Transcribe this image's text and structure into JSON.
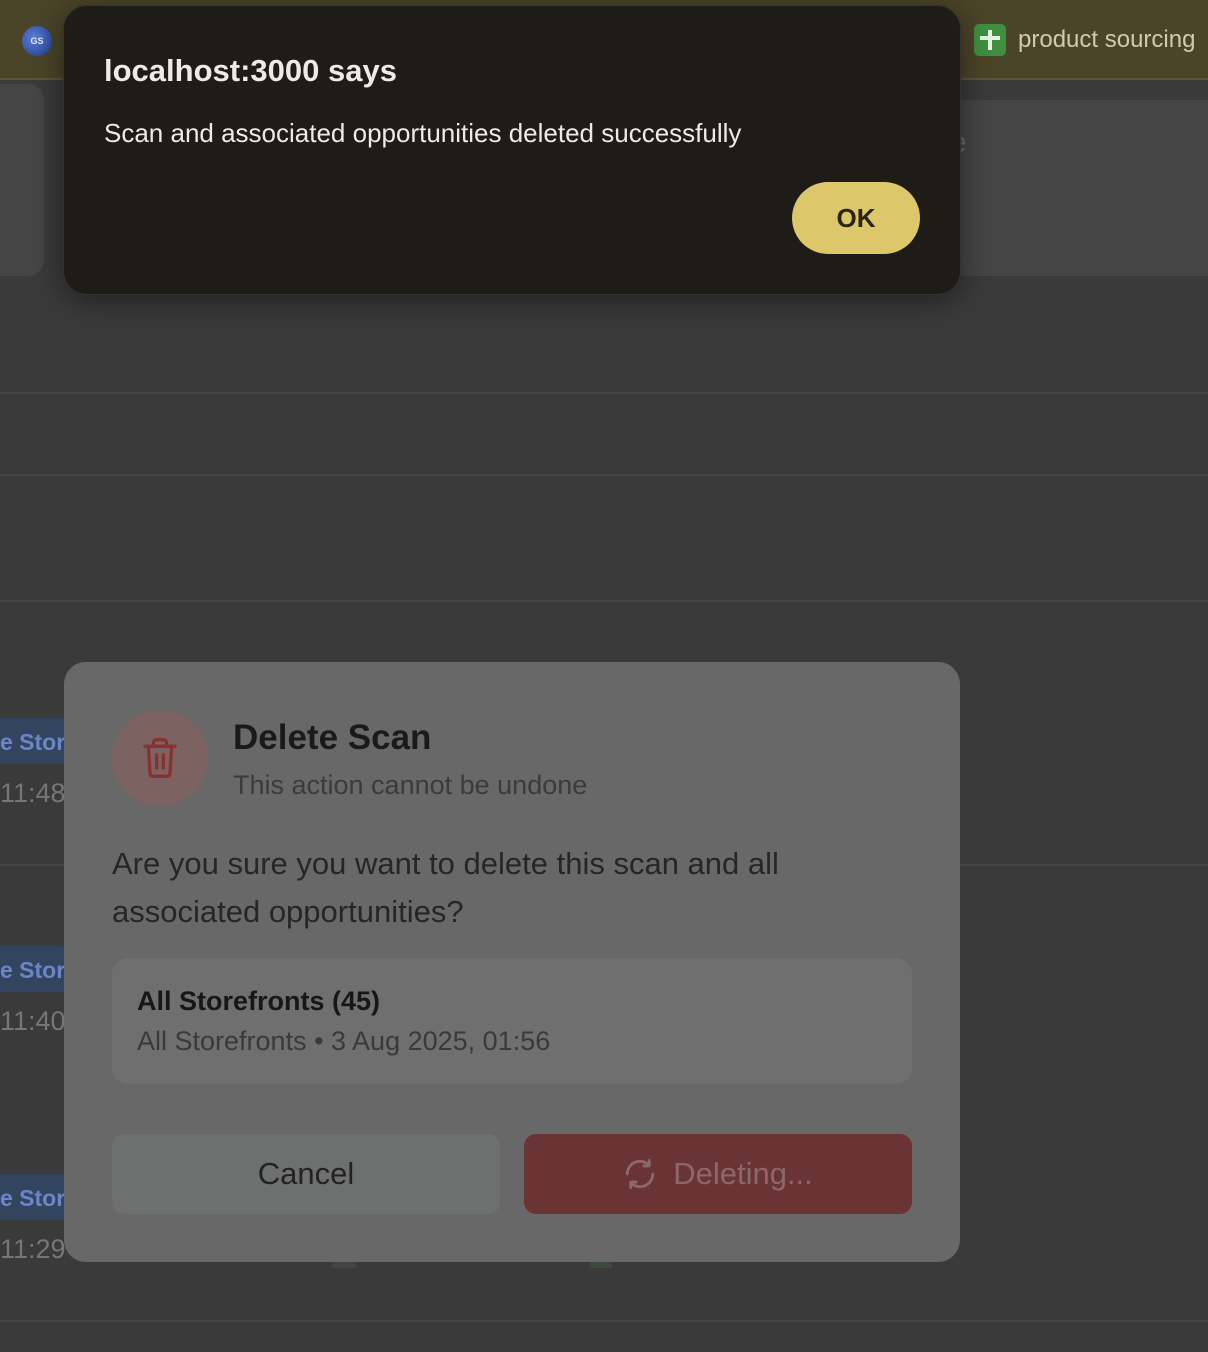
{
  "bookmarks_bar": {
    "sheet_bookmark_label": "product sourcing",
    "globe_text": "GS",
    "globe_icon": "globe-icon",
    "sheet_icon": "google-sheets-icon"
  },
  "background_rows": [
    {
      "tag": "e Store",
      "time": "11:48"
    },
    {
      "tag": "e Store",
      "time": "11:40"
    },
    {
      "tag": "e Store",
      "time": "11:29"
    }
  ],
  "background_ghost_char": "e",
  "delete_modal": {
    "icon": "trash-icon",
    "title": "Delete Scan",
    "subtitle": "This action cannot be undone",
    "question": "Are you sure you want to delete this scan and all associated opportunities?",
    "scan": {
      "name": "All Storefronts (45)",
      "meta": "All Storefronts • 3 Aug 2025, 01:56"
    },
    "cancel_label": "Cancel",
    "delete_label": "Deleting...",
    "delete_icon": "refresh-icon",
    "colors": {
      "danger": "#dc2626"
    }
  },
  "alert": {
    "title": "localhost:3000 says",
    "message": "Scan and associated opportunities deleted successfully",
    "ok_label": "OK",
    "colors": {
      "ok_button": "#dcc76a",
      "background": "#1e1c17"
    }
  }
}
